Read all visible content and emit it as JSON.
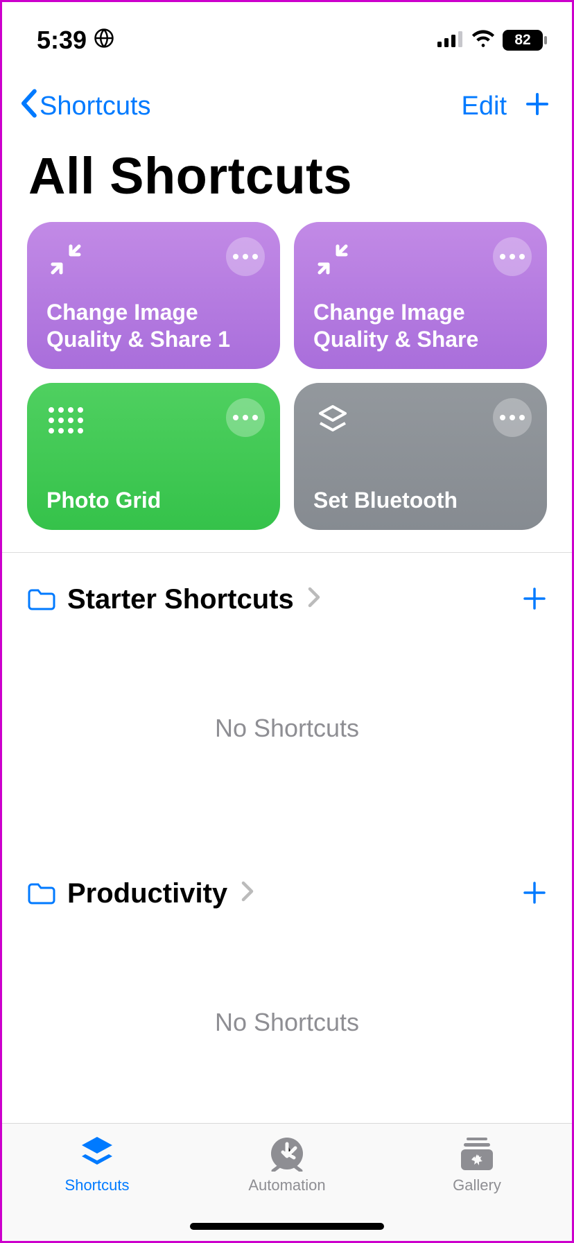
{
  "status": {
    "time": "5:39",
    "battery": "82"
  },
  "nav": {
    "back_label": "Shortcuts",
    "edit_label": "Edit"
  },
  "title": "All Shortcuts",
  "cards": [
    {
      "label": "Change Image Quality & Share 1"
    },
    {
      "label": "Change Image Quality & Share"
    },
    {
      "label": "Photo Grid"
    },
    {
      "label": "Set Bluetooth"
    }
  ],
  "sections": [
    {
      "title": "Starter Shortcuts",
      "empty": "No Shortcuts"
    },
    {
      "title": "Productivity",
      "empty": "No Shortcuts"
    }
  ],
  "tabs": [
    {
      "label": "Shortcuts"
    },
    {
      "label": "Automation"
    },
    {
      "label": "Gallery"
    }
  ]
}
